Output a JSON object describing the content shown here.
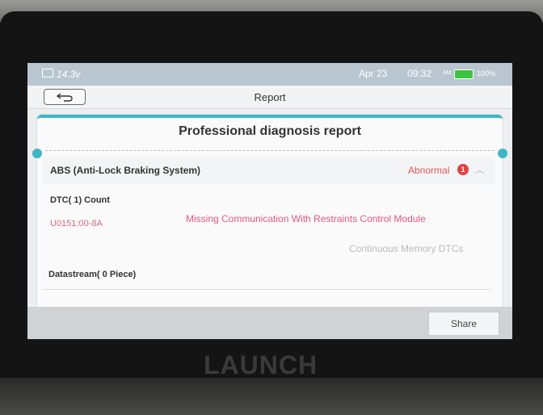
{
  "status": {
    "voltage": "14.3v",
    "date": "Apr 23",
    "time": "09:32",
    "ampm": "AM",
    "battery_percent": "100%"
  },
  "header": {
    "title": "Report"
  },
  "report": {
    "heading": "Professional diagnosis report",
    "system_name": "ABS (Anti-Lock Braking System)",
    "status_label": "Abnormal",
    "fault_badge": "1",
    "dtc_count_label": "DTC( 1) Count",
    "dtcs": [
      {
        "code": "U0151:00-8A",
        "description": "Missing Communication With Restraints Control Module",
        "type": "Continuous Memory DTCs"
      }
    ],
    "datastream_label": "Datastream( 0 Piece)"
  },
  "footer": {
    "share_label": "Share"
  },
  "device": {
    "brand": "LAUNCH"
  },
  "colors": {
    "accent": "#3fb5c6",
    "abnormal": "#e05a5a",
    "dtc": "#e05a7a",
    "battery": "#3cc43c"
  }
}
